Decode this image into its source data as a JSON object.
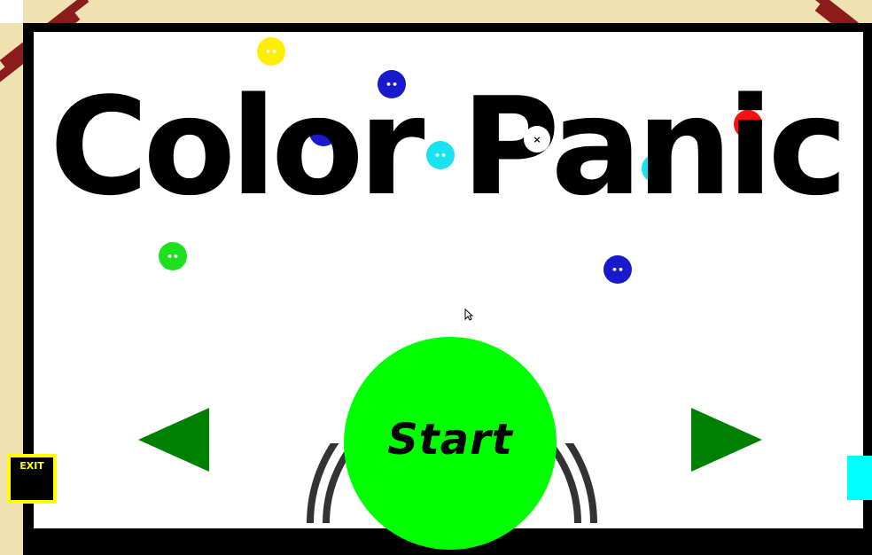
{
  "title": "Color Panic",
  "start_label": "Start",
  "exit_label": "EXIT",
  "colors": {
    "background": "#efe2b0",
    "frame": "#000000",
    "stripes": "#8b1c1c",
    "start_button": "#00ff00",
    "arrows": "#008000",
    "exit_border": "#ffff00",
    "ball_yellow": "#ffee00",
    "ball_blue": "#1a1acd",
    "ball_cyan": "#19e3f0",
    "ball_red": "#ff1010",
    "ball_green": "#1fe01f",
    "ball_white": "#ffffff"
  },
  "icons": {
    "left_arrow": "triangle-left-icon",
    "right_arrow": "triangle-right-icon",
    "cursor": "mouse-pointer-icon"
  }
}
